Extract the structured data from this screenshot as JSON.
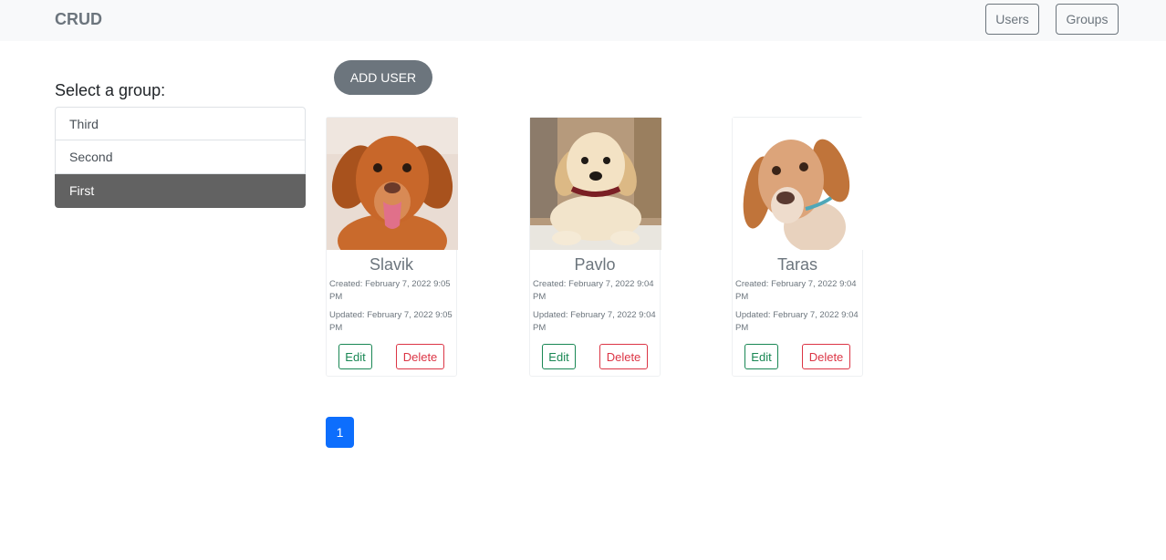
{
  "navbar": {
    "brand": "CRUD",
    "users_label": "Users",
    "groups_label": "Groups"
  },
  "sidebar": {
    "title": "Select a group:",
    "groups": [
      {
        "label": "Third",
        "active": false
      },
      {
        "label": "Second",
        "active": false
      },
      {
        "label": "First",
        "active": true
      }
    ]
  },
  "toolbar": {
    "add_user_label": "ADD USER"
  },
  "users": [
    {
      "name": "Slavik",
      "created": "Created: February 7, 2022 9:05 PM",
      "updated": "Updated: February 7, 2022 9:05 PM",
      "edit_label": "Edit",
      "delete_label": "Delete",
      "photo": "dog-red-retriever"
    },
    {
      "name": "Pavlo",
      "created": "Created: February 7, 2022 9:04 PM",
      "updated": "Updated: February 7, 2022 9:04 PM",
      "edit_label": "Edit",
      "delete_label": "Delete",
      "photo": "dog-golden-puppy"
    },
    {
      "name": "Taras",
      "created": "Created: February 7, 2022 9:04 PM",
      "updated": "Updated: February 7, 2022 9:04 PM",
      "edit_label": "Edit",
      "delete_label": "Delete",
      "photo": "dog-beagle-puppy"
    }
  ],
  "pagination": {
    "pages": [
      "1"
    ],
    "current": "1"
  },
  "colors": {
    "navbar_bg": "#f8f9fa",
    "secondary": "#6c757d",
    "active_group": "#626262",
    "success": "#198754",
    "danger": "#dc3545",
    "primary": "#0d6efd"
  }
}
